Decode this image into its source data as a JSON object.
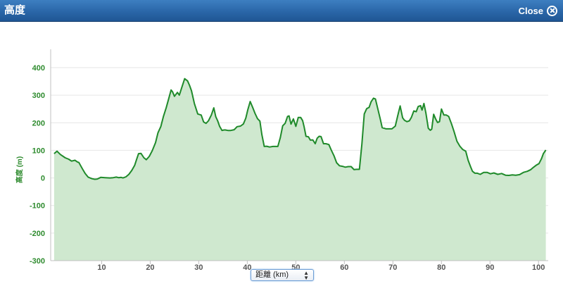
{
  "window": {
    "title": "高度",
    "close_label": "Close",
    "close_icon": "close-circle-icon"
  },
  "x_axis_selector": {
    "selected": "距離 (km)"
  },
  "colors": {
    "line": "#1f8a2a",
    "fill": "#cfe8cf",
    "axis_text_y": "#2e8b2e",
    "grid": "#e6e6e6",
    "titlebar": "#2a66a8"
  },
  "chart_data": {
    "type": "area",
    "title": "",
    "xlabel": "距離 (km)",
    "ylabel": "高度 (m)",
    "xlim": [
      0,
      102
    ],
    "ylim": [
      -300,
      400
    ],
    "x_ticks": [
      10,
      20,
      30,
      40,
      50,
      60,
      70,
      80,
      90,
      100
    ],
    "y_ticks": [
      -300,
      -200,
      -100,
      0,
      100,
      200,
      300,
      400
    ],
    "grid": true,
    "legend": "none",
    "series": [
      {
        "x": [
          0.2,
          0.8,
          1.5,
          2.5,
          3.2,
          3.8,
          4.5,
          5.0,
          5.3,
          6.0,
          6.6,
          7.2,
          8.0,
          8.6,
          9.1,
          9.8,
          10.7,
          11.7,
          12.4,
          13.0,
          13.5,
          14.0,
          14.4,
          15.0,
          15.6,
          16.2,
          16.8,
          17.2,
          17.6,
          18.1,
          18.7,
          19.2,
          19.8,
          20.4,
          21.1,
          21.6,
          22.2,
          22.7,
          23.3,
          23.8,
          24.3,
          24.6,
          25.0,
          25.6,
          26.0,
          26.5,
          27.1,
          27.7,
          28.1,
          28.5,
          29.1,
          29.8,
          30.5,
          31.0,
          31.5,
          32.0,
          32.6,
          33.1,
          33.5,
          33.9,
          34.3,
          34.8,
          35.2,
          35.5,
          36.0,
          36.6,
          37.3,
          37.9,
          38.6,
          39.2,
          39.7,
          40.1,
          40.6,
          41.1,
          41.6,
          42.1,
          42.6,
          43.0,
          43.5,
          44.0,
          44.6,
          45.3,
          45.9,
          46.3,
          46.8,
          47.3,
          47.8,
          48.3,
          48.6,
          49.0,
          49.5,
          50.0,
          50.5,
          51.0,
          51.4,
          51.7,
          52.1,
          52.6,
          53.0,
          53.5,
          54.0,
          54.4,
          54.8,
          55.2,
          55.7,
          56.2,
          56.8,
          57.3,
          57.9,
          58.4,
          59.0,
          59.6,
          60.2,
          60.8,
          61.4,
          62.0,
          62.5,
          63.1,
          63.6,
          64.1,
          64.6,
          65.1,
          65.5,
          66.0,
          66.4,
          66.9,
          67.4,
          67.8,
          68.2,
          68.6,
          69.1,
          69.8,
          70.5,
          71.0,
          71.5,
          72.0,
          72.4,
          72.9,
          73.4,
          73.8,
          74.3,
          74.8,
          75.2,
          75.7,
          76.0,
          76.4,
          76.8,
          77.3,
          77.7,
          78.0,
          78.4,
          78.8,
          79.2,
          79.6,
          80.0,
          80.5,
          81.0,
          81.5,
          82.1,
          82.6,
          83.2,
          83.8,
          84.4,
          85.0,
          85.5,
          86.0,
          86.4,
          86.9,
          87.4,
          88.0,
          88.7,
          89.4,
          90.1,
          90.8,
          91.6,
          92.4,
          93.2,
          93.9,
          94.6,
          95.3,
          96.1,
          96.9,
          97.7,
          98.4,
          99.0,
          99.6,
          100.1,
          100.6,
          101.0,
          101.5
        ],
        "values": [
          88,
          97,
          85,
          73,
          68,
          61,
          64,
          58,
          56,
          34,
          16,
          3,
          -3,
          -5,
          -4,
          2,
          1,
          0,
          1,
          3,
          1,
          2,
          0,
          4,
          13,
          27,
          46,
          67,
          88,
          89,
          73,
          66,
          78,
          98,
          128,
          164,
          187,
          222,
          255,
          287,
          319,
          312,
          296,
          310,
          300,
          328,
          360,
          352,
          336,
          316,
          270,
          232,
          228,
          203,
          198,
          207,
          228,
          254,
          222,
          207,
          187,
          172,
          174,
          174,
          172,
          172,
          175,
          186,
          188,
          196,
          217,
          247,
          277,
          256,
          234,
          215,
          206,
          157,
          114,
          115,
          112,
          114,
          114,
          114,
          146,
          189,
          198,
          223,
          225,
          195,
          214,
          187,
          219,
          219,
          208,
          186,
          151,
          149,
          137,
          138,
          124,
          144,
          151,
          150,
          124,
          124,
          121,
          101,
          79,
          55,
          44,
          42,
          39,
          41,
          41,
          30,
          31,
          31,
          122,
          232,
          251,
          256,
          276,
          289,
          286,
          250,
          213,
          182,
          180,
          178,
          178,
          178,
          188,
          226,
          261,
          218,
          209,
          204,
          207,
          219,
          243,
          240,
          259,
          262,
          246,
          270,
          235,
          180,
          173,
          177,
          231,
          214,
          201,
          204,
          250,
          228,
          228,
          223,
          195,
          168,
          133,
          115,
          103,
          97,
          64,
          41,
          24,
          17,
          17,
          13,
          20,
          20,
          15,
          18,
          13,
          16,
          10,
          9,
          11,
          10,
          12,
          20,
          24,
          30,
          39,
          47,
          52,
          69,
          88,
          101
        ]
      }
    ]
  }
}
